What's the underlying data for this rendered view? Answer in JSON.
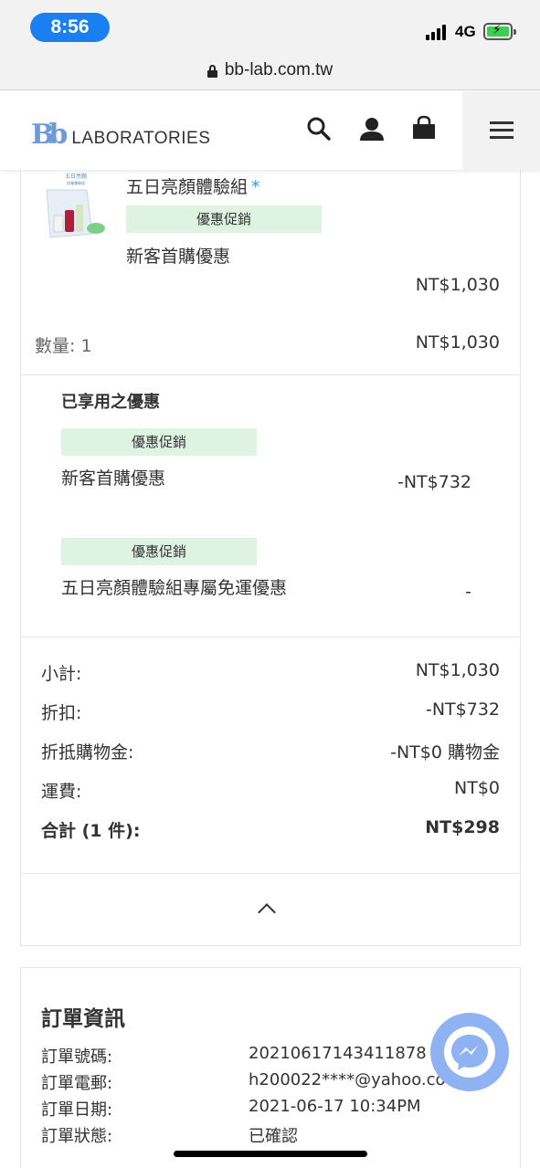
{
  "status_bar": {
    "time": "8:56",
    "network": "4G",
    "accent": "#1a7ff0"
  },
  "browser": {
    "url": "bb-lab.com.tw"
  },
  "header": {
    "logo_mark": "Bb",
    "logo_text": "LABORATORIES",
    "icons": [
      "search-icon",
      "user-icon",
      "cart-icon",
      "menu-icon"
    ]
  },
  "item": {
    "name": "五日亮顏體驗組",
    "required_mark": "*",
    "promo_tag": "優惠促銷",
    "promo_name": "新客首購優惠",
    "unit_price": "NT$1,030",
    "quantity_label": "數量: 1",
    "line_total": "NT$1,030"
  },
  "discounts": {
    "title": "已享用之優惠",
    "items": [
      {
        "tag": "優惠促銷",
        "name": "新客首購優惠",
        "amount": "-NT$732"
      },
      {
        "tag": "優惠促銷",
        "name": "五日亮顏體驗組專屬免運優惠",
        "amount": "-"
      }
    ]
  },
  "summary": {
    "rows": [
      {
        "label": "小計:",
        "value": "NT$1,030"
      },
      {
        "label": "折扣:",
        "value": "-NT$732"
      },
      {
        "label": "折抵購物金:",
        "value": "-NT$0 購物金"
      },
      {
        "label": "運費:",
        "value": "NT$0"
      }
    ],
    "total_label": "合計 (1 件):",
    "total_value": "NT$298"
  },
  "order_info": {
    "title": "訂單資訊",
    "rows": [
      {
        "label": "訂單號碼:",
        "value": "20210617143411878"
      },
      {
        "label": "訂單電郵:",
        "value": "h200022****@yahoo.co"
      },
      {
        "label": "訂單日期:",
        "value": "2021-06-17 10:34PM"
      },
      {
        "label": "訂單狀態:",
        "value": "已確認"
      }
    ]
  },
  "colors": {
    "promo_bg": "#dff3e3",
    "messenger": "#8fb2f2",
    "logo": "#6f9ad8"
  }
}
